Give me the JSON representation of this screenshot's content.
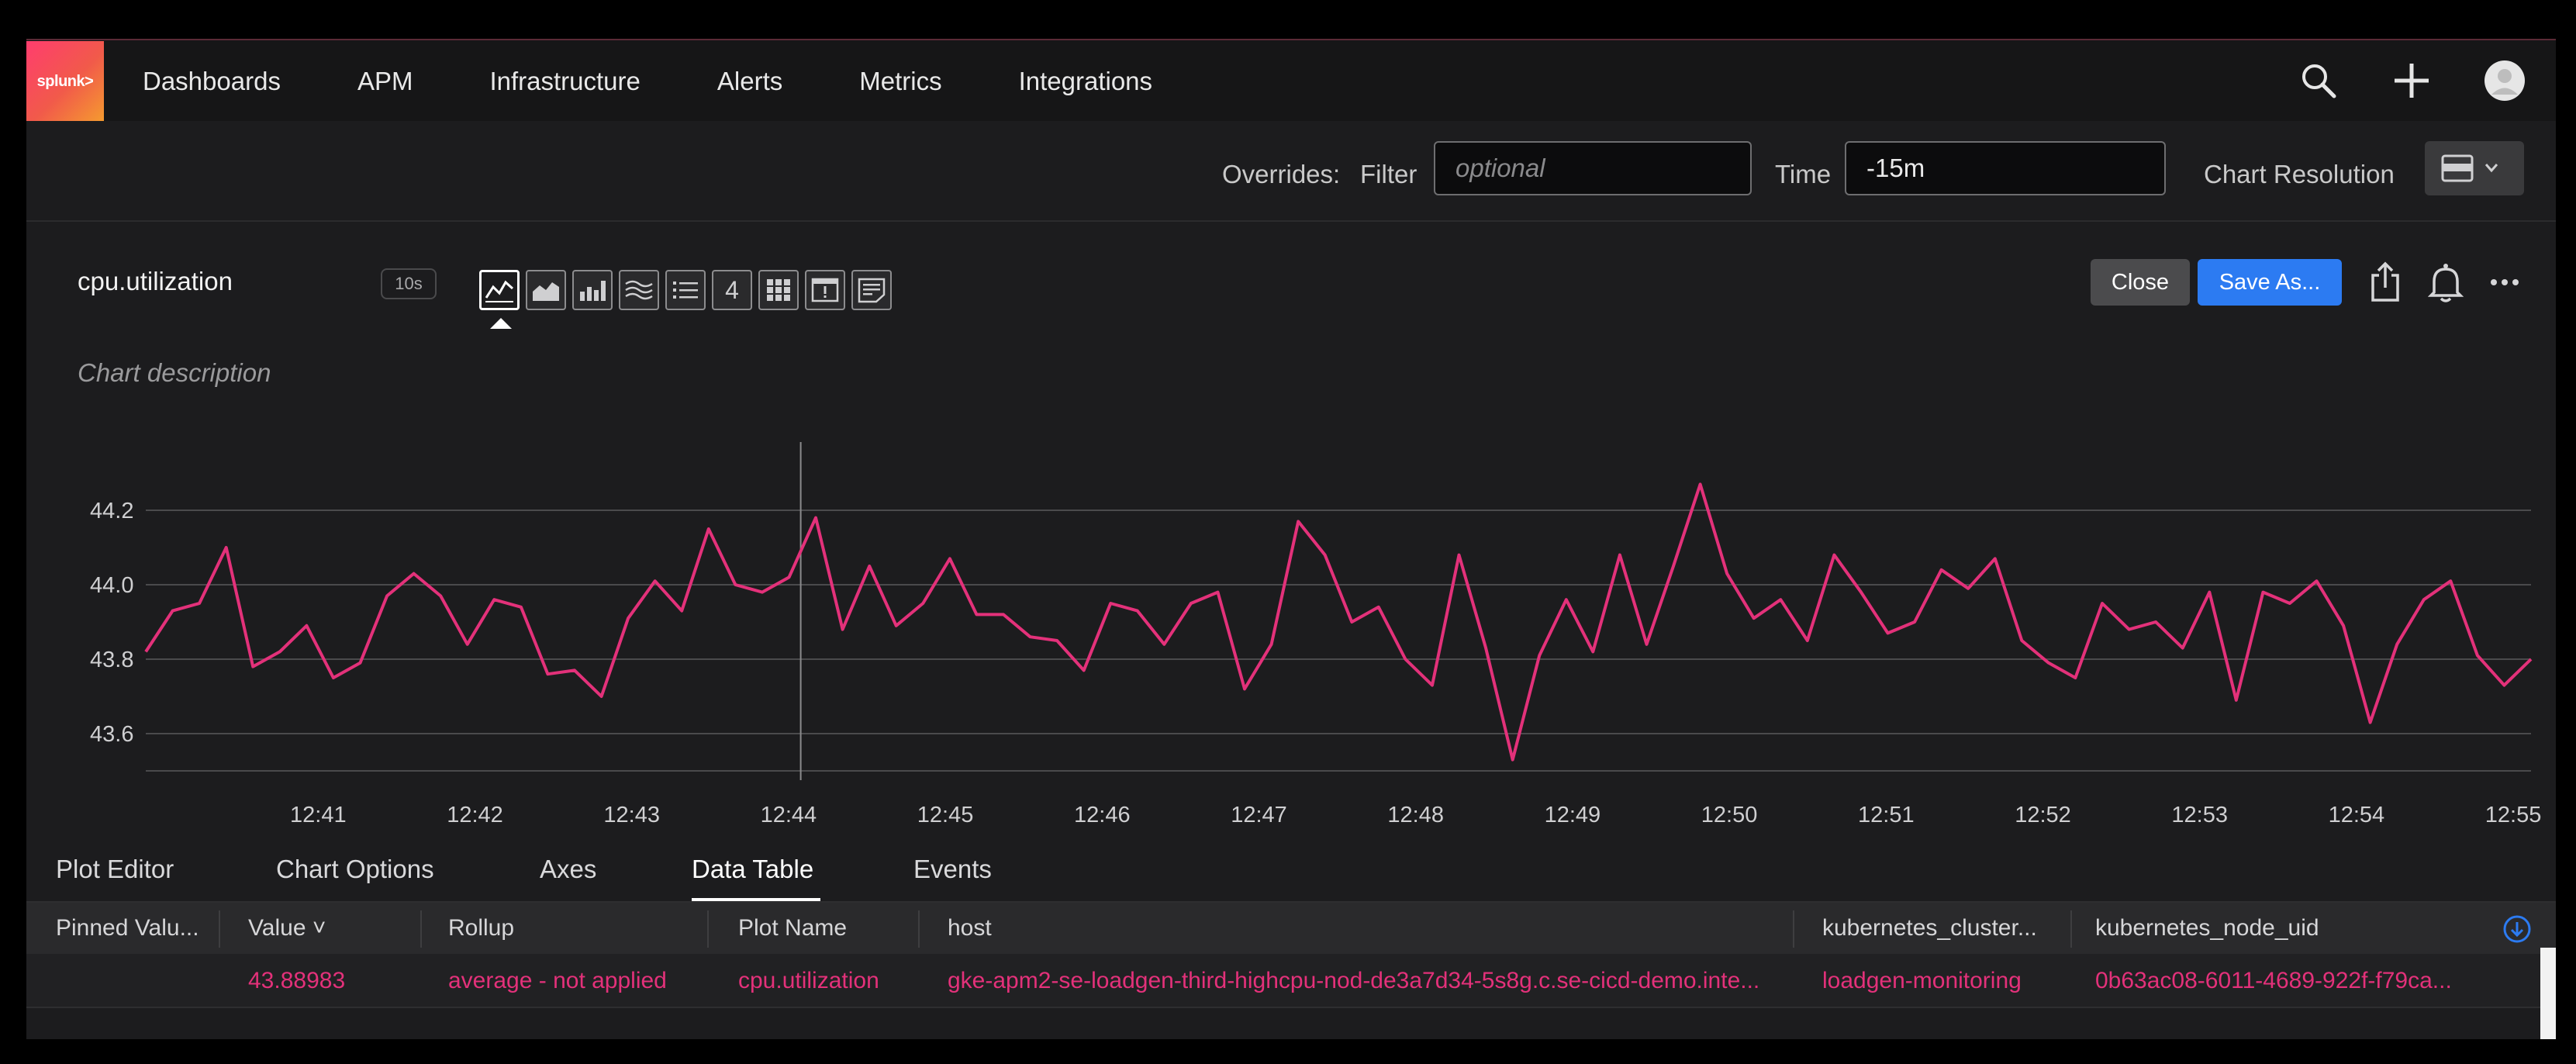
{
  "nav": {
    "logo_text": "splunk>",
    "items": [
      "Dashboards",
      "APM",
      "Infrastructure",
      "Alerts",
      "Metrics",
      "Integrations"
    ],
    "icons": [
      "search-icon",
      "plus-icon",
      "user-avatar-icon"
    ]
  },
  "overrides": {
    "label": "Overrides:",
    "filter_label": "Filter",
    "filter_placeholder": "optional",
    "filter_value": "",
    "time_label": "Time",
    "time_value": "-15m",
    "resolution_label": "Chart Resolution"
  },
  "chart_header": {
    "title": "cpu.utilization",
    "resolution_badge": "10s",
    "description_placeholder": "Chart description",
    "viz_types": [
      "line",
      "area",
      "column",
      "histogram",
      "list",
      "single-value",
      "heatmap",
      "event-feed",
      "text"
    ],
    "single_value_glyph": "4",
    "close_label": "Close",
    "save_label": "Save As..."
  },
  "chart_data": {
    "type": "line",
    "series": [
      {
        "color": "#e3317a",
        "values": [
          43.82,
          43.93,
          43.95,
          44.1,
          43.78,
          43.82,
          43.89,
          43.75,
          43.79,
          43.97,
          44.03,
          43.97,
          43.84,
          43.96,
          43.94,
          43.76,
          43.77,
          43.7,
          43.91,
          44.01,
          43.93,
          44.15,
          44.0,
          43.98,
          44.02,
          44.18,
          43.88,
          44.05,
          43.89,
          43.95,
          44.07,
          43.92,
          43.92,
          43.86,
          43.85,
          43.77,
          43.95,
          43.93,
          43.84,
          43.95,
          43.98,
          43.72,
          43.84,
          44.17,
          44.08,
          43.9,
          43.94,
          43.8,
          43.73,
          44.08,
          43.83,
          43.53,
          43.81,
          43.96,
          43.82,
          44.08,
          43.84,
          44.05,
          44.27,
          44.03,
          43.91,
          43.96,
          43.85,
          44.08,
          43.98,
          43.87,
          43.9,
          44.04,
          43.99,
          44.07,
          43.85,
          43.79,
          43.75,
          43.95,
          43.88,
          43.9,
          43.83,
          43.98,
          43.69,
          43.98,
          43.95,
          44.01,
          43.89,
          43.63,
          43.84,
          43.96,
          44.01,
          43.81,
          43.73,
          43.8
        ]
      }
    ],
    "x_ticks": [
      "12:41",
      "12:42",
      "12:43",
      "12:44",
      "12:45",
      "12:46",
      "12:47",
      "12:48",
      "12:49",
      "12:50",
      "12:51",
      "12:52",
      "12:53",
      "12:54",
      "12:55"
    ],
    "y_ticks": [
      "44.2",
      "44.0",
      "43.8",
      "43.6"
    ],
    "ylim": [
      43.5,
      44.3
    ],
    "grid": true,
    "cursor_time": "12:44"
  },
  "tabs": {
    "items": [
      "Plot Editor",
      "Chart Options",
      "Axes",
      "Data Table",
      "Events"
    ],
    "active": "Data Table"
  },
  "table": {
    "columns": [
      "Pinned Valu...",
      "Value",
      "Rollup",
      "Plot Name",
      "host",
      "kubernetes_cluster...",
      "kubernetes_node_uid"
    ],
    "sort_indicator": "˅",
    "rows": [
      [
        "",
        "43.88983",
        "average - not applied",
        "cpu.utilization",
        "gke-apm2-se-loadgen-third-highcpu-nod-de3a7d34-5s8g.c.se-cicd-demo.inte...",
        "loadgen-monitoring",
        "0b63ac08-6011-4689-922f-f79ca..."
      ]
    ]
  }
}
